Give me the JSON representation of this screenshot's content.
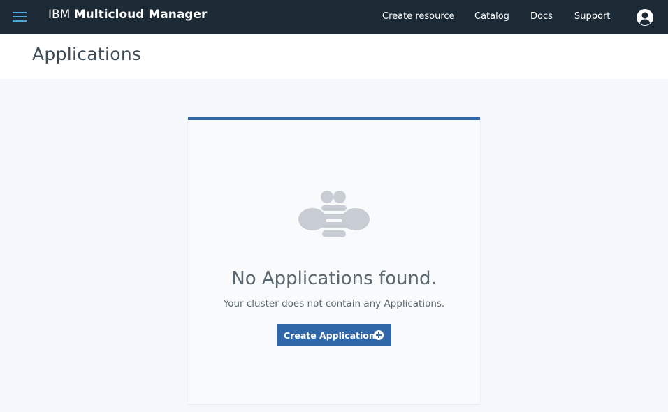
{
  "header": {
    "brand_prefix": "IBM",
    "brand_name": "Multicloud Manager",
    "menu_icon": "hamburger-menu-icon",
    "nav": [
      {
        "label": "Create resource"
      },
      {
        "label": "Catalog"
      },
      {
        "label": "Docs"
      },
      {
        "label": "Support"
      }
    ],
    "user_icon": "user-avatar-icon"
  },
  "page": {
    "title": "Applications"
  },
  "empty_state": {
    "illustration": "bee-icon",
    "title": "No Applications found.",
    "description": "Your cluster does not contain any Applications.",
    "button_label": "Create Application",
    "button_icon": "add-circle-icon"
  },
  "colors": {
    "topbar": "#1c2a36",
    "accent": "#3067a8",
    "menu_icon": "#4ea8de",
    "background": "#f4f7fb"
  }
}
